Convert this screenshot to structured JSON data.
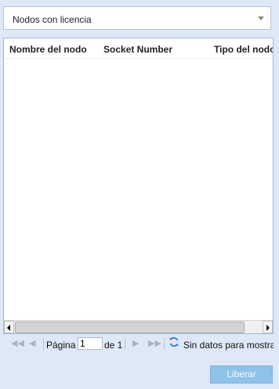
{
  "filter": {
    "selected": "Nodos con licencia"
  },
  "grid": {
    "columns": [
      "Nombre del nodo",
      "Socket Number",
      "Tipo del nodo"
    ]
  },
  "pager": {
    "page_label": "Página",
    "page_value": "1",
    "of_label": "de 1",
    "status": "Sin datos para mostrar"
  },
  "actions": {
    "release_label": "Liberar"
  }
}
